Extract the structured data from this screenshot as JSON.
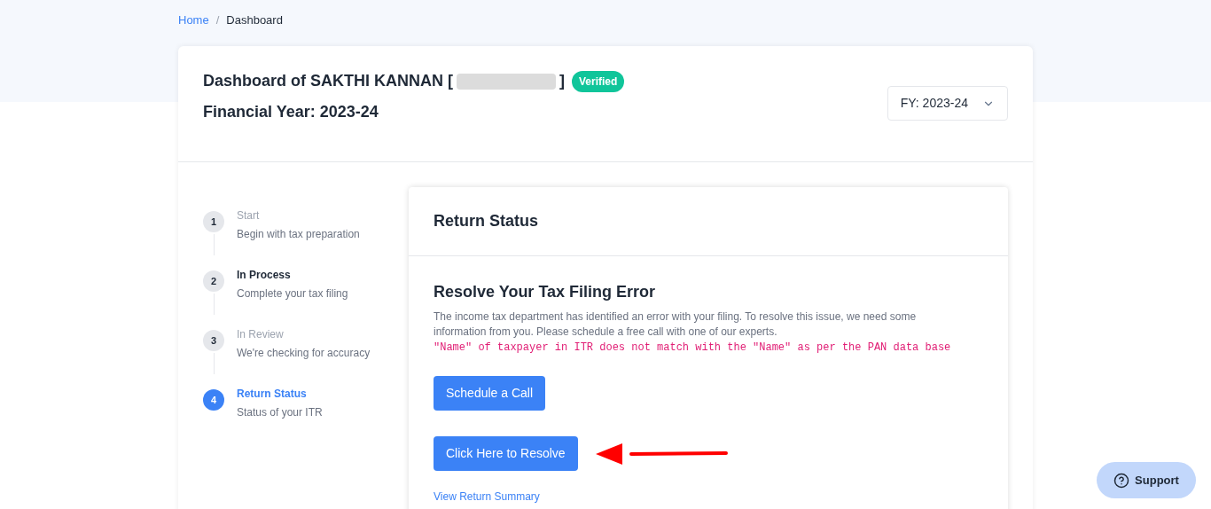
{
  "breadcrumb": [
    {
      "label": "Home",
      "link": true
    },
    {
      "label": "Dashboard",
      "link": false
    }
  ],
  "breadcrumb_separator": "/",
  "header": {
    "title": "Dashboard of SAKTHI KANNAN [",
    "title_end": "]",
    "id_redacted": true,
    "badge": "Verified",
    "subtitle": "Financial Year: 2023-24",
    "year_select": "FY: 2023-24"
  },
  "steps": [
    {
      "number": "1",
      "title": "Start",
      "description": "Begin with tax preparation",
      "highlighted": false,
      "selected": false
    },
    {
      "number": "2",
      "title": "In Process",
      "description": "Complete your tax filing",
      "highlighted": true,
      "selected": false
    },
    {
      "number": "3",
      "title": "In Review",
      "description": "We're checking for accuracy",
      "highlighted": false,
      "selected": false
    },
    {
      "number": "4",
      "title": "Return Status",
      "description": "Status of your ITR",
      "highlighted": false,
      "selected": true
    }
  ],
  "panel": {
    "title": "Return Status",
    "heading": "Resolve Your Tax Filing Error",
    "message": "The income tax department has identified an error with your filing. To resolve this issue, we need some information from you. Please schedule a free call with one of our experts.",
    "error": "\"Name\" of taxpayer in ITR does not match with the \"Name\" as per the PAN data base",
    "buttons": [
      "Schedule a Call",
      "Click Here to Resolve"
    ],
    "link": "View Return Summary"
  },
  "support": "Support"
}
